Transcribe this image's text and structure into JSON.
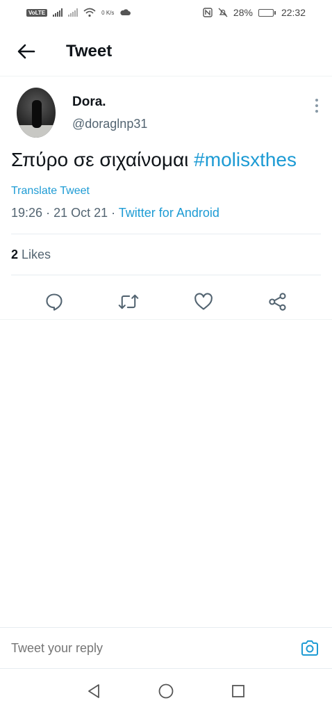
{
  "status_bar": {
    "network_badge": "VoLTE",
    "speed": "0 K/s",
    "battery_percent": "28%",
    "battery_level": 0.28,
    "time": "22:32"
  },
  "header": {
    "title": "Tweet",
    "back_icon": "arrow-left-icon"
  },
  "tweet": {
    "display_name": "Dora.",
    "handle": "@doraglnp31",
    "text": "Σπύρο σε σιχαίνομαι",
    "hashtag": "#molisxthes",
    "translate_label": "Translate Tweet",
    "time": "19:26",
    "date": "21 Oct 21",
    "source": "Twitter for Android",
    "likes_count": "2",
    "likes_label": "Likes"
  },
  "actions": {
    "icons": [
      "reply-icon",
      "retweet-icon",
      "like-icon",
      "share-icon"
    ]
  },
  "reply_bar": {
    "placeholder": "Tweet your reply"
  },
  "colors": {
    "accent": "#1d9bd4",
    "text": "#0f1419",
    "secondary": "#536471"
  }
}
